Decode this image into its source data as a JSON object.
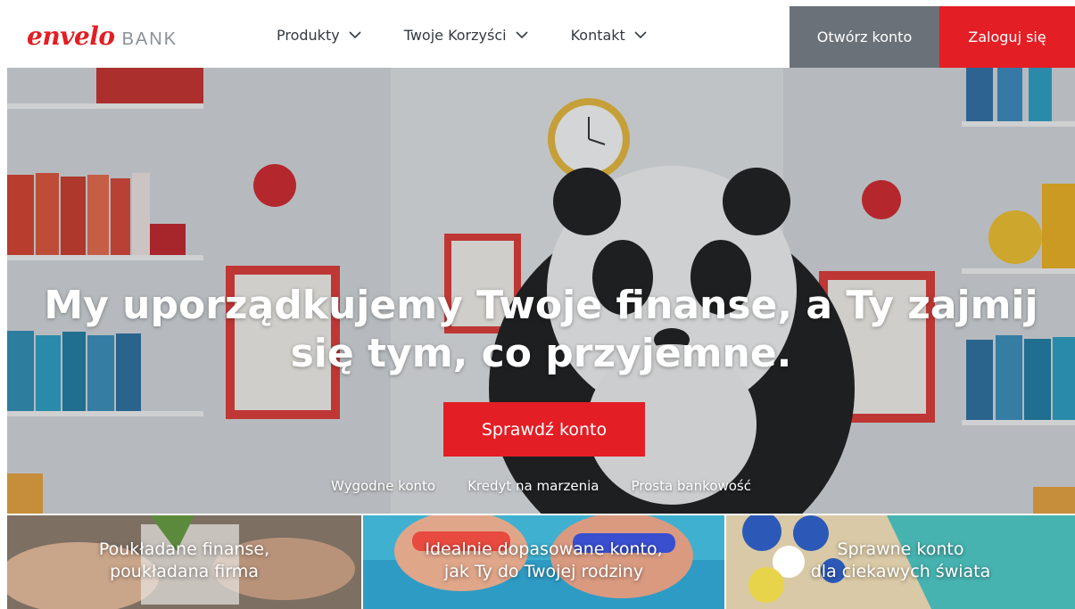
{
  "brand": {
    "name": "envelo",
    "suffix": "BANK",
    "color": "#e31e24"
  },
  "nav": {
    "items": [
      {
        "label": "Produkty"
      },
      {
        "label": "Twoje Korzyści"
      },
      {
        "label": "Kontakt"
      }
    ]
  },
  "header_buttons": {
    "open_account": "Otwórz konto",
    "login": "Zaloguj się"
  },
  "hero": {
    "title_line1": "My uporządkujemy Twoje finanse, a Ty zajmij",
    "title_line2": "się tym, co przyjemne.",
    "cta": "Sprawdź konto",
    "links": [
      "Wygodne konto",
      "Kredyt na marzenia",
      "Prosta bankowość"
    ]
  },
  "tiles": [
    {
      "line1": "Poukładane finanse,",
      "line2": "poukładana firma"
    },
    {
      "line1": "Idealnie dopasowane konto,",
      "line2": "jak Ty do Twojej rodziny"
    },
    {
      "line1": "Sprawne konto",
      "line2": "dla ciekawych świata"
    }
  ],
  "colors": {
    "accent": "#e31e24",
    "secondary": "#6b7178",
    "text": "#333a40"
  }
}
